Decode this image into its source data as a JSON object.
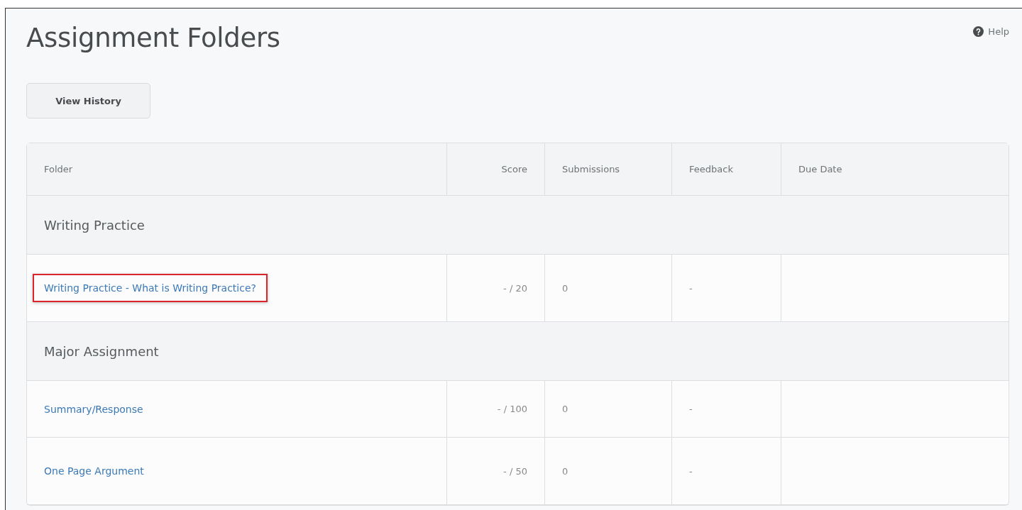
{
  "page": {
    "title": "Assignment Folders",
    "help": "Help"
  },
  "buttons": [
    "View History"
  ],
  "table": {
    "columns": [
      "Folder",
      "Score",
      "Submissions",
      "Feedback",
      "Due Date"
    ],
    "rows": [
      {
        "kind": "group",
        "name": "Writing Practice"
      },
      {
        "kind": "item",
        "name": "Writing Practice - What is Writing Practice?",
        "highlighted": true,
        "score": "- / 20",
        "submissions": "0",
        "feedback": "-"
      },
      {
        "kind": "group",
        "name": "Major Assignment"
      },
      {
        "kind": "item",
        "name": "Summary/Response",
        "highlighted": false,
        "score": "- / 100",
        "submissions": "0",
        "feedback": "-"
      },
      {
        "kind": "item",
        "name": "One Page Argument",
        "highlighted": false,
        "score": "- / 50",
        "submissions": "0",
        "feedback": "-"
      }
    ]
  }
}
